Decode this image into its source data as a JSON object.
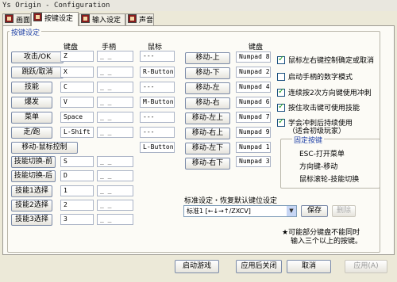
{
  "window": {
    "title": "Ys Origin - Configuration"
  },
  "tabs": [
    {
      "label": "画面"
    },
    {
      "label": "按键设定"
    },
    {
      "label": "输入设定"
    },
    {
      "label": "声音"
    }
  ],
  "group_title": "按键设定",
  "columns": {
    "keyboard": "键盘",
    "gamepad": "手柄",
    "mouse": "鼠标",
    "keyboard2": "键盘"
  },
  "actions": [
    {
      "label": "攻击/OK",
      "key": "Z",
      "pad": "_ _",
      "mouse": "---"
    },
    {
      "label": "跳跃/取消",
      "key": "X",
      "pad": "_ _",
      "mouse": "R-Button"
    },
    {
      "label": "技能",
      "key": "C",
      "pad": "_ _",
      "mouse": "---"
    },
    {
      "label": "爆发",
      "key": "V",
      "pad": "_ _",
      "mouse": "M-Button"
    },
    {
      "label": "菜单",
      "key": "Space",
      "pad": "_ _",
      "mouse": "---"
    },
    {
      "label": "走/跑",
      "key": "L-Shift",
      "pad": "_ _",
      "mouse": "---"
    },
    {
      "label": "移动-鼠标控制",
      "mouse": "L-Button"
    },
    {
      "label": "技能切换-前",
      "key": "S",
      "pad": "_ _"
    },
    {
      "label": "技能切换-后",
      "key": "D",
      "pad": "_ _"
    },
    {
      "label": "技能1选择",
      "key": "1",
      "pad": "_ _"
    },
    {
      "label": "技能2选择",
      "key": "2",
      "pad": "_ _"
    },
    {
      "label": "技能3选择",
      "key": "3",
      "pad": "_ _"
    }
  ],
  "moves": [
    {
      "label": "移动-上",
      "key": "Numpad 8"
    },
    {
      "label": "移动-下",
      "key": "Numpad 2"
    },
    {
      "label": "移动-左",
      "key": "Numpad 4"
    },
    {
      "label": "移动-右",
      "key": "Numpad 6"
    },
    {
      "label": "移动-左上",
      "key": "Numpad 7"
    },
    {
      "label": "移动-右上",
      "key": "Numpad 9"
    },
    {
      "label": "移动-左下",
      "key": "Numpad 1"
    },
    {
      "label": "移动-右下",
      "key": "Numpad 3"
    }
  ],
  "options": [
    {
      "label": "鼠标左右键控制确定或取消",
      "checked": true
    },
    {
      "label": "启动手柄的数字模式",
      "checked": false
    },
    {
      "label": "连续按2次方向键使用冲刺",
      "checked": true
    },
    {
      "label": "按住攻击键可使用技能",
      "checked": true
    },
    {
      "label": "学会冲刺后持续使用",
      "label2": "（适合初级玩家）",
      "checked": true
    }
  ],
  "fixed_keys": {
    "title": "固定按键",
    "items": [
      "ESC-打开菜单",
      "方向键-移动",
      "鼠标滚轮-技能切换"
    ]
  },
  "preset": {
    "title": "标准设定・恢复默认键位设定",
    "selected": "标准1 [←↓→↑/ZXCV]",
    "save_label": "保存",
    "delete_label": "删除"
  },
  "note": {
    "line1": "★可能部分键盘不能同时",
    "line2": "输入三个以上的按键。"
  },
  "bottom_buttons": {
    "launch": "启动游戏",
    "apply_close": "应用后关闭",
    "cancel": "取消",
    "apply": "应用(A)"
  },
  "colors": {
    "group_title": "#2646a8",
    "check": "#21a121"
  }
}
